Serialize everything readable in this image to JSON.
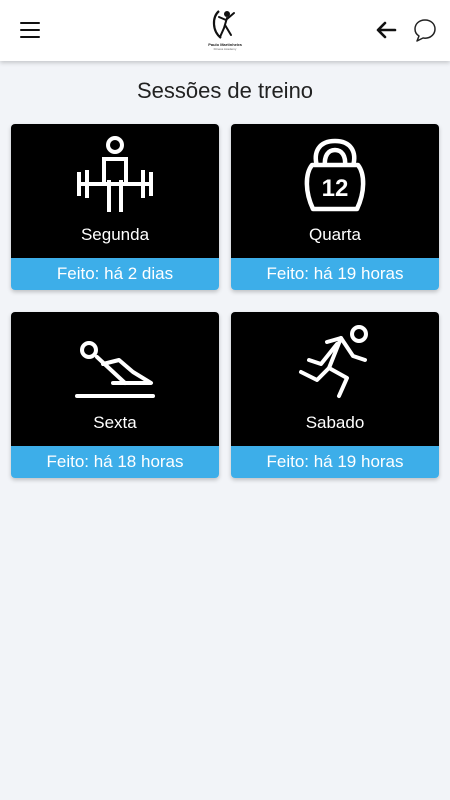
{
  "header": {
    "menu_icon": "hamburger-menu-icon",
    "logo": {
      "name": "Paulo Martinheira",
      "tagline": "Fitness Academy"
    },
    "back_icon": "arrow-left-icon",
    "chat_icon": "chat-bubble-icon"
  },
  "page": {
    "title": "Sessões de treino"
  },
  "sessions": [
    {
      "day": "Segunda",
      "status": "Feito: há 2 dias",
      "icon": "weightlifter-icon"
    },
    {
      "day": "Quarta",
      "status": "Feito: há 19 horas",
      "icon": "kettlebell-12-icon",
      "icon_text": "12"
    },
    {
      "day": "Sexta",
      "status": "Feito: há 18 horas",
      "icon": "situp-exercise-icon"
    },
    {
      "day": "Sabado",
      "status": "Feito: há 19 horas",
      "icon": "running-person-icon"
    }
  ],
  "colors": {
    "card_bg": "#000000",
    "status_bg": "#3daee9",
    "page_bg": "#f2f4f8"
  }
}
